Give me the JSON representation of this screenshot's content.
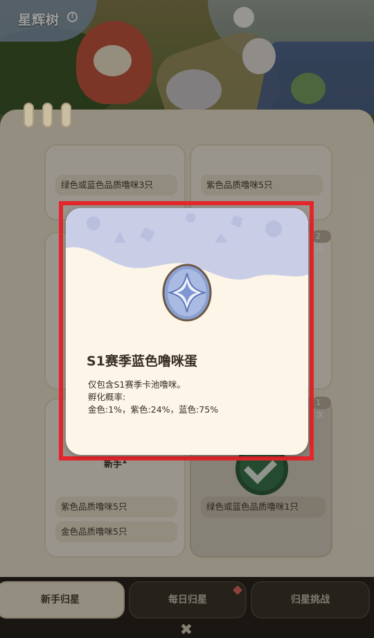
{
  "header": {
    "title": "星辉树",
    "help_icon": "help-circle-icon"
  },
  "cards": {
    "top_left_req": "绿色或蓝色品质噜咪3只",
    "top_right_req": "紫色品质噜咪5只",
    "right_mid_count": "2次",
    "right_bottom_count": "1次",
    "bottom_left_label": "新手",
    "bottom_left_label_num": "1",
    "bottom_left_req1": "紫色品质噜咪5只",
    "bottom_left_req2": "金色品质噜咪5只",
    "bottom_right_req": "绿色或蓝色品质噜咪1只",
    "bottom_right_icon": "check-badge-icon"
  },
  "tabs": [
    {
      "label": "新手归星",
      "active": true
    },
    {
      "label": "每日归星",
      "active": false,
      "has_dot": true
    },
    {
      "label": "归星挑战",
      "active": false
    }
  ],
  "close_icon": "chevron-down-icon",
  "popup": {
    "item_icon": "blue-egg-icon",
    "title": "S1赛季蓝色噜咪蛋",
    "desc_line1": "仅包含S1赛季卡池噜咪。",
    "desc_line2": "孵化概率:",
    "desc_line3": "金色:1%，紫色:24%，蓝色:75%"
  },
  "colors": {
    "highlight": "#e3262b",
    "panel": "#efe6cf",
    "popup_bg": "#fdf6e8",
    "banner": "#c9cde6"
  }
}
